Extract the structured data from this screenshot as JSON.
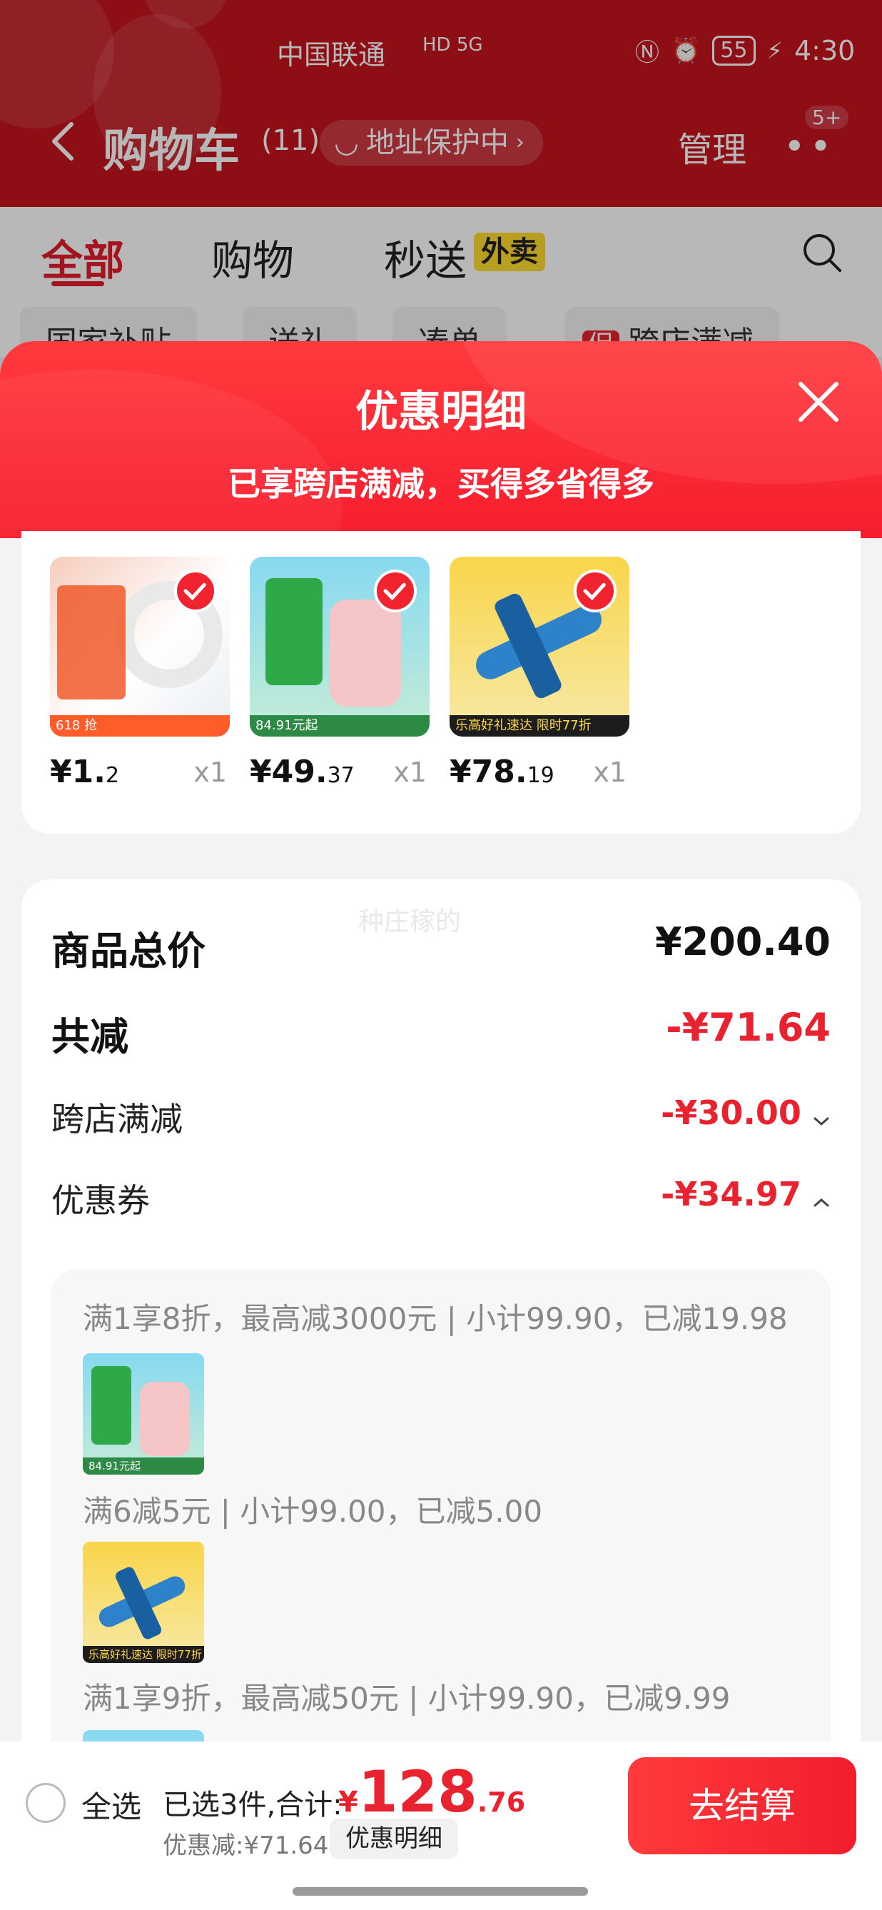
{
  "status": {
    "carrier": "中国联通",
    "network": "HD 5G",
    "battery": "55",
    "time": "4:30"
  },
  "header": {
    "title": "购物车",
    "count": "(11)",
    "address_pill": "地址保护中",
    "manage": "管理",
    "more_badge": "5+"
  },
  "tabs": [
    {
      "label": "全部"
    },
    {
      "label": "购物"
    },
    {
      "label": "秒送"
    }
  ],
  "takeout_badge": "外卖",
  "chips": [
    {
      "label": "国家补贴"
    },
    {
      "label": "送礼"
    },
    {
      "label": "凑单"
    },
    {
      "label": "跨店满减"
    }
  ],
  "promo_badge": "促",
  "modal": {
    "title": "优惠明细",
    "subtitle": "已享跨店满减，买得多省得多"
  },
  "products": [
    {
      "price_int": "¥1.",
      "price_dec": "2",
      "qty": "x1",
      "thumb_text": "618 抢",
      "colors": [
        "#f4d4c4",
        "#ffffff"
      ]
    },
    {
      "price_int": "¥49.",
      "price_dec": "37",
      "qty": "x1",
      "thumb_text": "84.91元起",
      "colors": [
        "#7fd4c8",
        "#f2c8c8"
      ]
    },
    {
      "price_int": "¥78.",
      "price_dec": "19",
      "qty": "x1",
      "thumb_text": "乐高好礼速达 限时77折",
      "colors": [
        "#f7c84a",
        "#f6e39a"
      ]
    }
  ],
  "summary": {
    "watermark": "种庄稼的",
    "goods_total_label": "商品总价",
    "goods_total_value": "¥200.40",
    "total_reduce_label": "共减",
    "total_reduce_value": "-¥71.64",
    "cross_store_label": "跨店满减",
    "cross_store_value": "-¥30.00",
    "coupon_label": "优惠券",
    "coupon_value": "-¥34.97"
  },
  "coupon_lines": [
    "满1享8折，最高减3000元 | 小计99.90，已减19.98",
    "满6减5元 | 小计99.00，已减5.00",
    "满1享9折，最高减50元 | 小计99.90，已减9.99"
  ],
  "coupon_thumbs": [
    {
      "label": "84.91元起"
    },
    {
      "label": "乐高好礼速达 限时77折"
    },
    {
      "label": ""
    }
  ],
  "bottom": {
    "select_all": "全选",
    "selected_prefix": "已选3件,合计:",
    "yen": "¥",
    "total_int": "128",
    "total_dec": ".76",
    "discount": "优惠减:¥71.64",
    "detail_btn": "优惠明细",
    "checkout": "去结算"
  },
  "accent": "#e8232f"
}
